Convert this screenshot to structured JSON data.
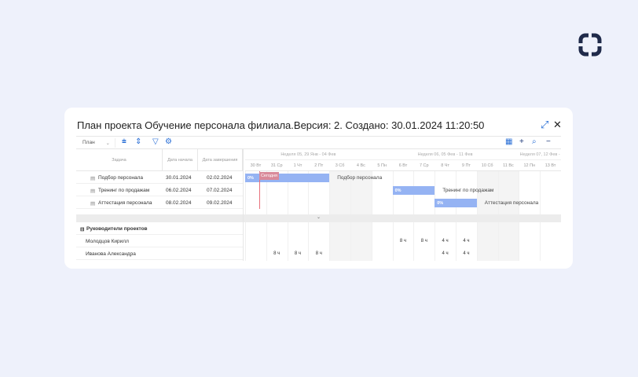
{
  "title": "План проекта  Обучение персонала филиала.Версия: 2. Создано: 30.01.2024 11:20:50",
  "icons": {
    "logo": "logo-rounded-square",
    "expand": "expand-icon",
    "close": "close-icon"
  },
  "toolbar": {
    "view": "План",
    "zoom_in": "+",
    "zoom_out": "−"
  },
  "columns": {
    "task": "Задача",
    "start": "Дата начала",
    "end": "Дата завершения"
  },
  "weeks": [
    "Неделя 05, 29 Янв - 04 Фев",
    "Неделя 06, 05 Фев - 11 Фев",
    "Неделя 07, 12 Фев -"
  ],
  "days": [
    "30 Вт",
    "31 Ср",
    "1 Чт",
    "2 Пт",
    "3 Сб",
    "4 Вс",
    "5 Пн",
    "6 Вт",
    "7 Ср",
    "8 Чт",
    "9 Пт",
    "10 Сб",
    "11 Вс",
    "12 Пн",
    "13 Вт"
  ],
  "today_label": "Сегодня",
  "tasks": [
    {
      "name": "Подбор персонала",
      "start": "30.01.2024",
      "end": "02.02.2024",
      "progress": "0%"
    },
    {
      "name": "Тренинг по продажам",
      "start": "06.02.2024",
      "end": "07.02.2024",
      "progress": "0%"
    },
    {
      "name": "Аттестация персонала",
      "start": "08.02.2024",
      "end": "09.02.2024",
      "progress": "0%"
    }
  ],
  "group": "Руководители проектов",
  "resources": [
    {
      "name": "Молодцов Кирилл",
      "hours": [
        "",
        "",
        "",
        "",
        "",
        "",
        "",
        "8 ч",
        "8 ч",
        "4 ч",
        "4 ч",
        "",
        "",
        "",
        ""
      ]
    },
    {
      "name": "Иванова Александра",
      "hours": [
        "",
        "8 ч",
        "8 ч",
        "8 ч",
        "",
        "",
        "",
        "",
        "",
        "4 ч",
        "4 ч",
        "",
        "",
        "",
        ""
      ]
    }
  ],
  "colors": {
    "bar": "#95b3f3",
    "today": "#e8707a",
    "accent": "#2a6fd6"
  }
}
